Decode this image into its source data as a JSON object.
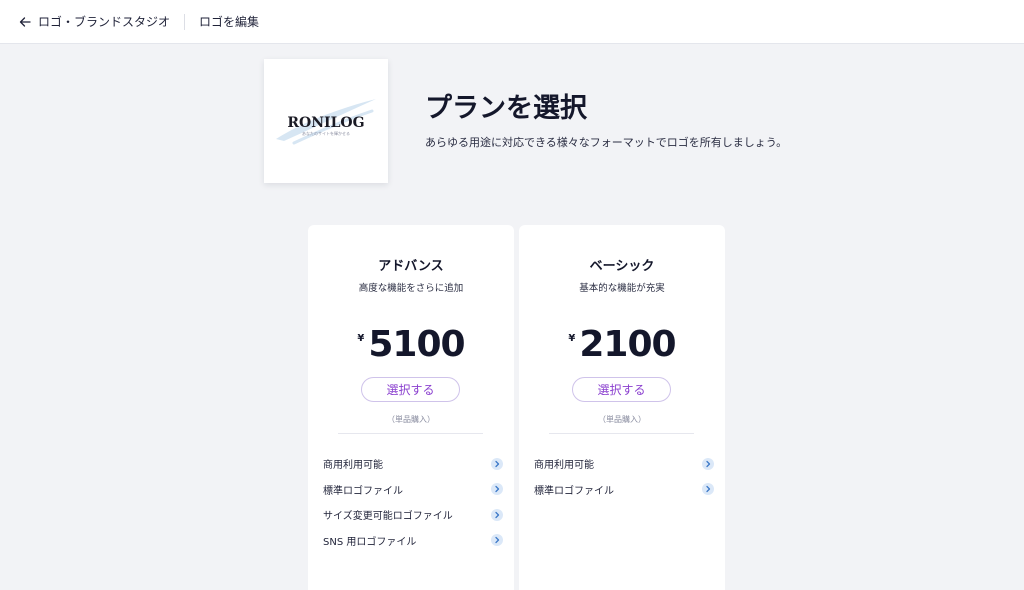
{
  "header": {
    "back_label": "ロゴ・ブランドスタジオ",
    "edit_label": "ロゴを編集"
  },
  "logo": {
    "brand_text": "RONILOG",
    "tagline": "あなたのサイトを輝かせる"
  },
  "page": {
    "title": "プランを選択",
    "subtitle": "あらゆる用途に対応できる様々なフォーマットでロゴを所有しましょう。"
  },
  "plans": [
    {
      "name": "アドバンス",
      "description": "高度な機能をさらに追加",
      "currency": "¥",
      "price": "5100",
      "button_label": "選択する",
      "purchase_note": "（単品購入）",
      "features": [
        "商用利用可能",
        "標準ロゴファイル",
        "サイズ変更可能ロゴファイル",
        "SNS 用ロゴファイル"
      ]
    },
    {
      "name": "ベーシック",
      "description": "基本的な機能が充実",
      "currency": "¥",
      "price": "2100",
      "button_label": "選択する",
      "purchase_note": "（単品購入）",
      "features": [
        "商用利用可能",
        "標準ロゴファイル"
      ]
    }
  ],
  "colors": {
    "accent": "#8a3fcf",
    "chevron_bg": "#dbe8f8",
    "chevron_fg": "#3c78c8"
  },
  "icons": {
    "back": "arrow-left-icon",
    "feature": "chevron-right-icon"
  }
}
